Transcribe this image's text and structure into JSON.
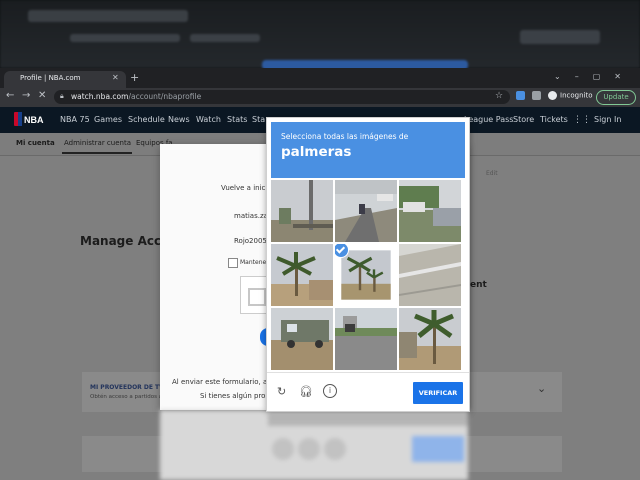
{
  "browser": {
    "tab_title": "Profile | NBA.com",
    "new_tab": "+",
    "url_host": "watch.nba.com",
    "url_path": "/account/nbaprofile",
    "incognito_label": "Incognito",
    "update_label": "Update"
  },
  "site": {
    "logo_text": "NBA",
    "nav": [
      "NBA 75",
      "Games",
      "Schedule",
      "News",
      "Watch",
      "Stats",
      "Sta"
    ],
    "nav_right": [
      "League Pass",
      "Store",
      "Tickets",
      "Sign In"
    ],
    "subnav": [
      "Mi cuenta",
      "Administrar cuenta",
      "Equipos fa"
    ],
    "page_title": "Manage Acco",
    "right_heading": "ent",
    "provider_title": "MI PROVEEDOR DE TV",
    "provider_text": "Obtén acceso a partidos a",
    "pill_text": "Edit"
  },
  "login_modal": {
    "prompt": "Vuelve a inicia",
    "email_value": "matias.zav",
    "password_value": "Rojo2005",
    "remember_label": "Mantener",
    "disclaimer": "Al enviar este formulario, acep",
    "help_text": "Si tienes algún proble"
  },
  "recaptcha": {
    "instruction": "Selecciona todas las imágenes de",
    "target": "palmeras",
    "verify_label": "VERIFICAR",
    "selected_tiles": [
      4
    ],
    "icons": [
      "reload-icon",
      "audio-icon",
      "info-icon"
    ]
  },
  "colors": {
    "captcha_blue": "#4a90e2",
    "verify_blue": "#1a73e8",
    "nba_header": "#0b1723",
    "update_green": "#81c995"
  }
}
